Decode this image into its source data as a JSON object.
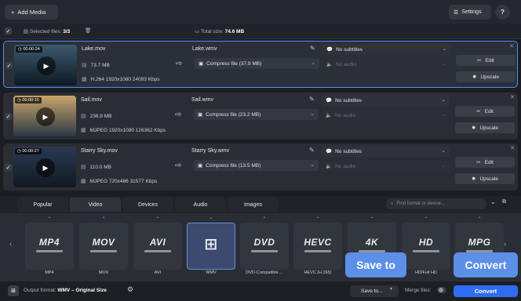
{
  "topbar": {
    "add_media": "Add Media",
    "settings": "Settings",
    "help": "?"
  },
  "status": {
    "selected_label": "Selected files:",
    "selected_value": "3/3",
    "total_label": "Total size:",
    "total_value": "74.6 MB"
  },
  "files": [
    {
      "duration": "00:00:24",
      "name": "Lake.mov",
      "size": "73.7 MB",
      "codec": "H.264 1920x1080 24093 Kbps",
      "output": "Lake.wmv",
      "compress": "Compress file (37.9 MB)",
      "subtitles": "No subtitles",
      "audio": "No audio",
      "edit": "Edit",
      "upscale": "Upscale",
      "thumb_colors": [
        "#3b5a6e",
        "#0e1a24"
      ]
    },
    {
      "duration": "00:00:15",
      "name": "Sail.mov",
      "size": "236.9 MB",
      "codec": "MJPEG 1920x1080 126362 Kbps",
      "output": "Sail.wmv",
      "compress": "Compress file (23.2 MB)",
      "subtitles": "No subtitles",
      "audio": "No audio",
      "edit": "Edit",
      "upscale": "Upscale",
      "thumb_colors": [
        "#c9a46a",
        "#2b3846"
      ]
    },
    {
      "duration": "00:00:27",
      "name": "Starry Sky.mov",
      "size": "110.0 MB",
      "codec": "MJPEG 720x486 31577 Kbps",
      "output": "Starry Sky.wmv",
      "compress": "Compress file (13.5 MB)",
      "subtitles": "No subtitles",
      "audio": "No audio",
      "edit": "Edit",
      "upscale": "Upscale",
      "thumb_colors": [
        "#2a3a56",
        "#111820"
      ]
    }
  ],
  "tabs": [
    "Popular",
    "Video",
    "Devices",
    "Audio",
    "Images"
  ],
  "selected_tab": "Video",
  "search": {
    "placeholder": "Find format or device..."
  },
  "formats": [
    {
      "logo": "MP4",
      "label": "MP4"
    },
    {
      "logo": "MOV",
      "label": "MOV"
    },
    {
      "logo": "AVI",
      "label": "AVI"
    },
    {
      "logo": "",
      "label": "WMV"
    },
    {
      "logo": "DVD",
      "label": "DVD-Compatible ..."
    },
    {
      "logo": "HEVC",
      "label": "HEVC (H.265)"
    },
    {
      "logo": "4K",
      "label": ""
    },
    {
      "logo": "HD",
      "label": "HD/Full HD"
    },
    {
      "logo": "MPG",
      "label": "MPG"
    }
  ],
  "bottom": {
    "output_label": "Output format:",
    "output_value": "WMV – Original Size",
    "save_to": "Save to...",
    "merge": "Merge files:",
    "convert": "Convert"
  },
  "tooltips": {
    "save": "Save to",
    "convert": "Convert"
  },
  "colors": {
    "accent": "#2f6df0",
    "tooltip": "#5b8fe8",
    "selected_border": "#4c8dff"
  }
}
